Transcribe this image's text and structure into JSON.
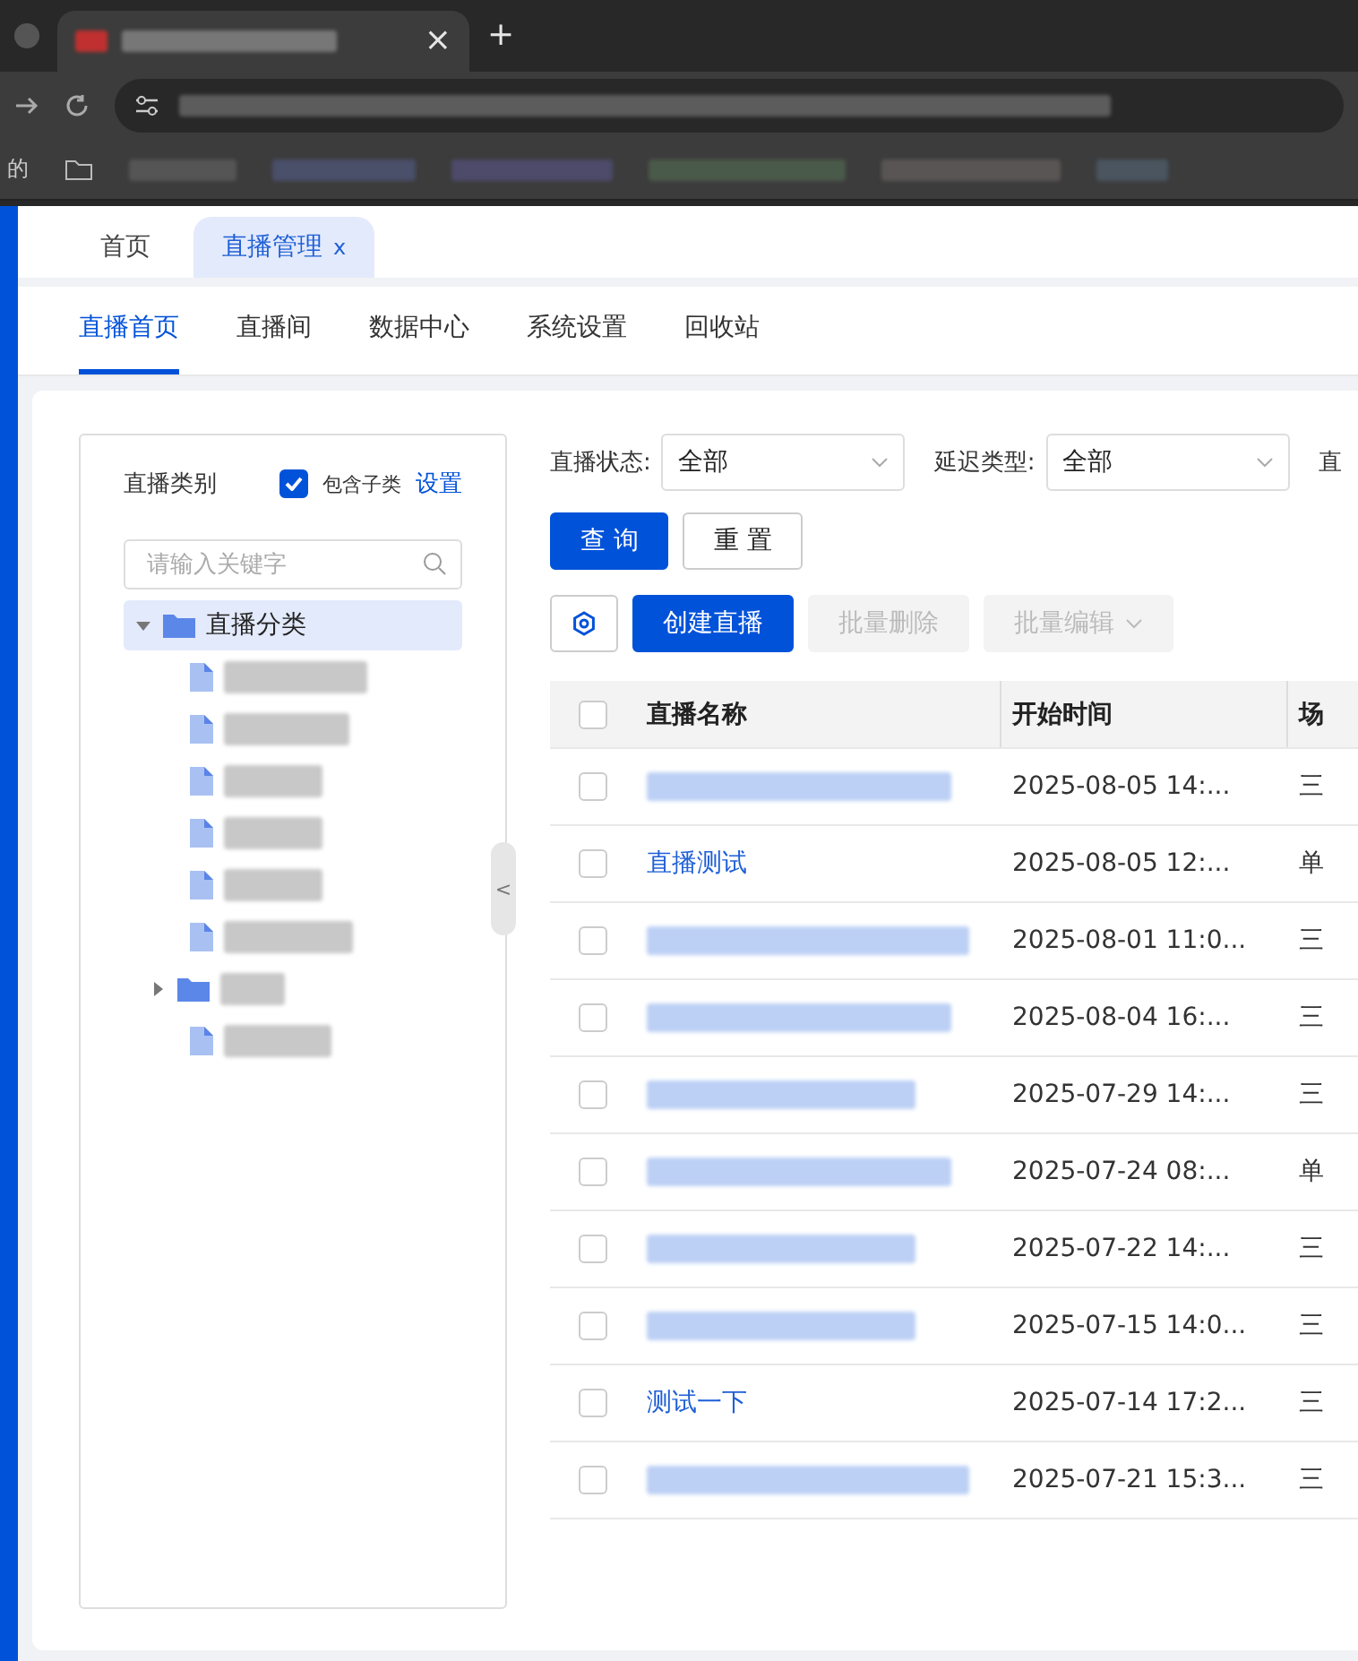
{
  "browser": {
    "new_tab": "+",
    "tab_close": "×",
    "bookmark_partial": "的"
  },
  "page_tabs": [
    {
      "label": "首页",
      "selected": false,
      "closable": false
    },
    {
      "label": "直播管理",
      "selected": true,
      "closable": true,
      "close": "x"
    }
  ],
  "nav": [
    {
      "label": "直播首页",
      "selected": true
    },
    {
      "label": "直播间",
      "selected": false
    },
    {
      "label": "数据中心",
      "selected": false
    },
    {
      "label": "系统设置",
      "selected": false
    },
    {
      "label": "回收站",
      "selected": false
    }
  ],
  "category_panel": {
    "title": "直播类别",
    "include_sub": {
      "label": "包含子类",
      "checked": true
    },
    "settings_link": "设置",
    "search": {
      "placeholder": "请输入关键字"
    },
    "tree": [
      {
        "label": "直播分类",
        "kind": "folder",
        "expanded": true,
        "selected": true,
        "children": [
          {
            "kind": "file",
            "selected": false
          },
          {
            "kind": "file",
            "selected": false
          },
          {
            "kind": "file",
            "selected": false
          },
          {
            "kind": "file",
            "selected": false
          },
          {
            "kind": "file",
            "selected": false
          },
          {
            "kind": "file",
            "selected": false
          },
          {
            "kind": "folder",
            "expanded": false,
            "selected": false
          },
          {
            "kind": "file",
            "selected": false
          }
        ]
      }
    ]
  },
  "collapse_handle": "<",
  "filters": [
    {
      "label": "直播状态:",
      "value": "全部"
    },
    {
      "label": "延迟类型:",
      "value": "全部"
    },
    {
      "label": "直"
    }
  ],
  "query_buttons": [
    {
      "label": "查 询",
      "kind": "primary"
    },
    {
      "label": "重 置",
      "kind": "default"
    }
  ],
  "actions": [
    {
      "label": "创建直播",
      "kind": "primary",
      "disabled": false
    },
    {
      "label": "批量删除",
      "kind": "default",
      "disabled": true
    },
    {
      "label": "批量编辑",
      "kind": "dropdown",
      "disabled": true
    }
  ],
  "table": {
    "all_checked": false,
    "columns": [
      "直播名称",
      "开始时间",
      "场"
    ],
    "rows": [
      {
        "kind": "redacted",
        "start": "2025-08-05 14:...",
        "scene": "三",
        "checked": false
      },
      {
        "kind": "text",
        "name": "直播测试",
        "start": "2025-08-05 12:...",
        "scene": "单",
        "checked": false
      },
      {
        "kind": "redacted",
        "start": "2025-08-01 11:0...",
        "scene": "三",
        "checked": false
      },
      {
        "kind": "redacted",
        "start": "2025-08-04 16:...",
        "scene": "三",
        "checked": false
      },
      {
        "kind": "redacted",
        "start": "2025-07-29 14:...",
        "scene": "三",
        "checked": false
      },
      {
        "kind": "redacted",
        "start": "2025-07-24 08:...",
        "scene": "单",
        "checked": false
      },
      {
        "kind": "redacted",
        "start": "2025-07-22 14:...",
        "scene": "三",
        "checked": false
      },
      {
        "kind": "redacted",
        "start": "2025-07-15 14:0...",
        "scene": "三",
        "checked": false
      },
      {
        "kind": "text",
        "name": "测试一下",
        "start": "2025-07-14 17:2...",
        "scene": "三",
        "checked": false
      },
      {
        "kind": "redacted",
        "start": "2025-07-21 15:3...",
        "scene": "三",
        "checked": false
      }
    ]
  }
}
